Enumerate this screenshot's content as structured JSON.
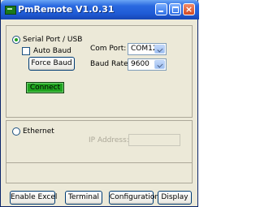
{
  "window": {
    "title": "PmRemote  V1.0.31"
  },
  "titlebar_buttons": {
    "minimize_icon": "minimize-icon",
    "maximize_icon": "maximize-icon",
    "close_glyph": "×"
  },
  "serial": {
    "radio_label": "Serial Port / USB",
    "selected": true,
    "auto_baud_label": "Auto Baud",
    "auto_baud_checked": false,
    "force_baud_label": "Force Baud",
    "com_port_label": "Com Port:",
    "com_port_value": "COM12",
    "baud_rate_label": "Baud Rate:",
    "baud_rate_value": "9600",
    "connect_label": "Connect"
  },
  "ethernet": {
    "radio_label": "Ethernet",
    "selected": false,
    "ip_label": "IP Address:",
    "ip_value": ""
  },
  "bottom_buttons": {
    "enable_excel": "Enable Excel",
    "terminal": "Terminal",
    "configuration": "Configuration",
    "display": "Display"
  },
  "colors": {
    "titlebar": "#2a69e0",
    "connect_button": "#1fa31f",
    "window_bg": "#ece9d8"
  }
}
